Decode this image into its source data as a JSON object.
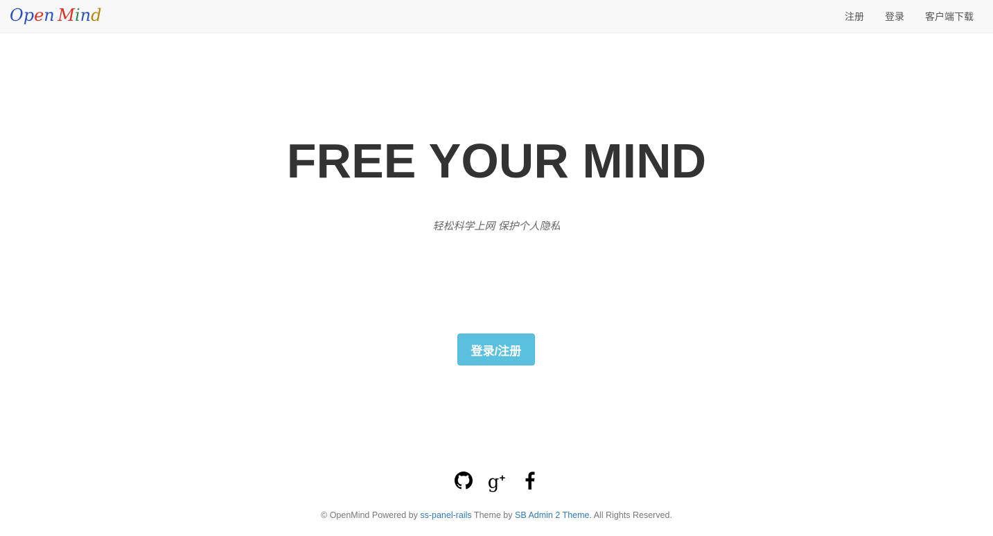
{
  "navbar": {
    "brand": {
      "letters": [
        {
          "ch": "O",
          "color": "#2a52be"
        },
        {
          "ch": "p",
          "color": "#2a52be"
        },
        {
          "ch": "e",
          "color": "#d93025"
        },
        {
          "ch": "n",
          "color": "#2a52be"
        },
        {
          "ch": " ",
          "color": "#2a52be"
        },
        {
          "ch": "M",
          "color": "#d93025"
        },
        {
          "ch": "i",
          "color": "#2e8b57"
        },
        {
          "ch": "n",
          "color": "#2a52be"
        },
        {
          "ch": "d",
          "color": "#b8860b"
        }
      ]
    },
    "links": {
      "register": "注册",
      "login": "登录",
      "download": "客户端下载"
    }
  },
  "hero": {
    "title": "FREE YOUR MIND",
    "subtitle": "轻松科学上网 保护个人隐私",
    "cta_label": "登录/注册",
    "cta_color": "#5bc0de"
  },
  "social": {
    "icons": [
      "github-icon",
      "google-plus-icon",
      "facebook-icon"
    ],
    "gplus_glyph": "g",
    "gplus_sup": "+",
    "facebook_glyph": "f"
  },
  "footer": {
    "prefix": "© OpenMind Powered by ",
    "link1": "ss-panel-rails",
    "middle": " Theme by ",
    "link2": "SB Admin 2 Theme.",
    "suffix": " All Rights Reserved.",
    "link_color": "#337ab7"
  }
}
